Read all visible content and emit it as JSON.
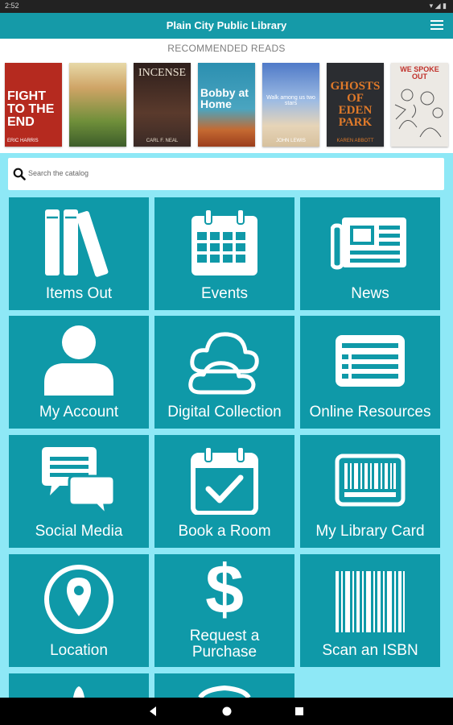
{
  "status": {
    "time": "2:52",
    "right_icons": "▾ ◢ ▮"
  },
  "app": {
    "title": "Plain City Public Library",
    "menu_icon": "hamburger-menu-icon"
  },
  "recommended": {
    "label": "RECOMMENDED READS",
    "books": [
      {
        "title": "FIGHT TO THE END",
        "author": "ERIC HARRIS",
        "bg": "#b52a1f"
      },
      {
        "title": "",
        "author": "",
        "bg": "#6f8f3a"
      },
      {
        "title": "INCENSE",
        "author": "CARL F. NEAL",
        "bg": "#3a2a26"
      },
      {
        "title": "Bobby at Home",
        "author": "",
        "bg": "#3c98b3"
      },
      {
        "title": "Walk among us two stars",
        "author": "JOHN LEWIS",
        "bg": "#7fa8d8"
      },
      {
        "title": "GHOSTS OF EDEN PARK",
        "author": "KAREN ABBOTT",
        "bg": "#2b2d31"
      },
      {
        "title": "WE SPOKE OUT",
        "author": "",
        "bg": "#ece9e4"
      }
    ]
  },
  "search": {
    "placeholder": "Search the catalog",
    "icon": "search-icon"
  },
  "tiles": [
    {
      "label": "Items Out",
      "icon": "books-icon"
    },
    {
      "label": "Events",
      "icon": "calendar-icon"
    },
    {
      "label": "News",
      "icon": "newspaper-icon"
    },
    {
      "label": "My Account",
      "icon": "user-icon"
    },
    {
      "label": "Digital Collection",
      "icon": "cloud-icon"
    },
    {
      "label": "Online Resources",
      "icon": "list-card-icon"
    },
    {
      "label": "Social Media",
      "icon": "chat-bubbles-icon"
    },
    {
      "label": "Book a Room",
      "icon": "calendar-check-icon"
    },
    {
      "label": "My Library Card",
      "icon": "barcode-card-icon"
    },
    {
      "label": "Location",
      "icon": "map-pin-icon"
    },
    {
      "label": "Request a Purchase",
      "icon": "dollar-icon"
    },
    {
      "label": "Scan an ISBN",
      "icon": "barcode-icon"
    }
  ],
  "nav": {
    "back": "back-icon",
    "home": "home-icon",
    "recents": "recents-icon"
  },
  "colors": {
    "appbar": "#159aa8",
    "tile": "#0f99a8",
    "background": "#8ee8f6"
  }
}
